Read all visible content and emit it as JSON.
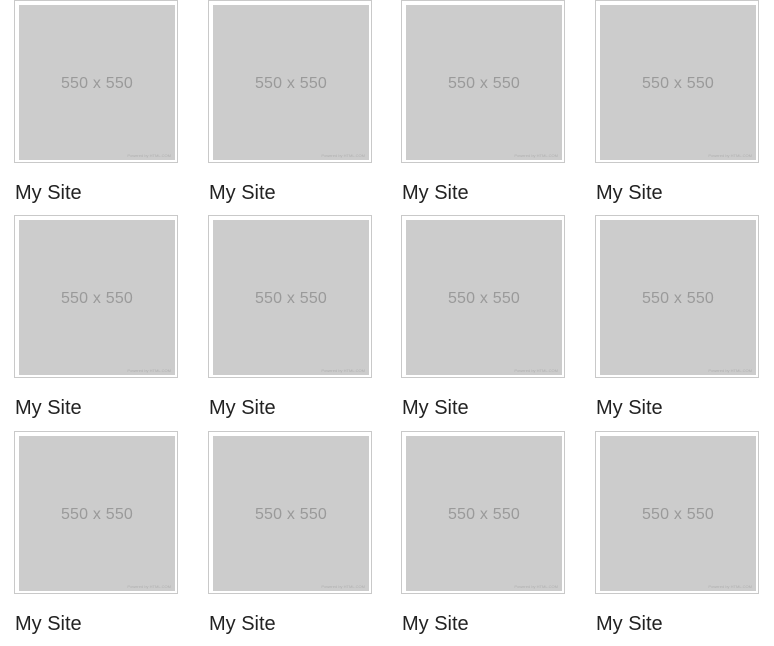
{
  "items": [
    {
      "title": "My Site",
      "placeholder": "550 x 550",
      "credit": "Powered by HTML.COM"
    },
    {
      "title": "My Site",
      "placeholder": "550 x 550",
      "credit": "Powered by HTML.COM"
    },
    {
      "title": "My Site",
      "placeholder": "550 x 550",
      "credit": "Powered by HTML.COM"
    },
    {
      "title": "My Site",
      "placeholder": "550 x 550",
      "credit": "Powered by HTML.COM"
    },
    {
      "title": "My Site",
      "placeholder": "550 x 550",
      "credit": "Powered by HTML.COM"
    },
    {
      "title": "My Site",
      "placeholder": "550 x 550",
      "credit": "Powered by HTML.COM"
    },
    {
      "title": "My Site",
      "placeholder": "550 x 550",
      "credit": "Powered by HTML.COM"
    },
    {
      "title": "My Site",
      "placeholder": "550 x 550",
      "credit": "Powered by HTML.COM"
    },
    {
      "title": "My Site",
      "placeholder": "550 x 550",
      "credit": "Powered by HTML.COM"
    },
    {
      "title": "My Site",
      "placeholder": "550 x 550",
      "credit": "Powered by HTML.COM"
    },
    {
      "title": "My Site",
      "placeholder": "550 x 550",
      "credit": "Powered by HTML.COM"
    },
    {
      "title": "My Site",
      "placeholder": "550 x 550",
      "credit": "Powered by HTML.COM"
    }
  ],
  "colors": {
    "placeholder_bg": "#cccccc",
    "placeholder_text": "#9a9a9a",
    "border": "#c9c9c9",
    "caption": "#222222"
  }
}
